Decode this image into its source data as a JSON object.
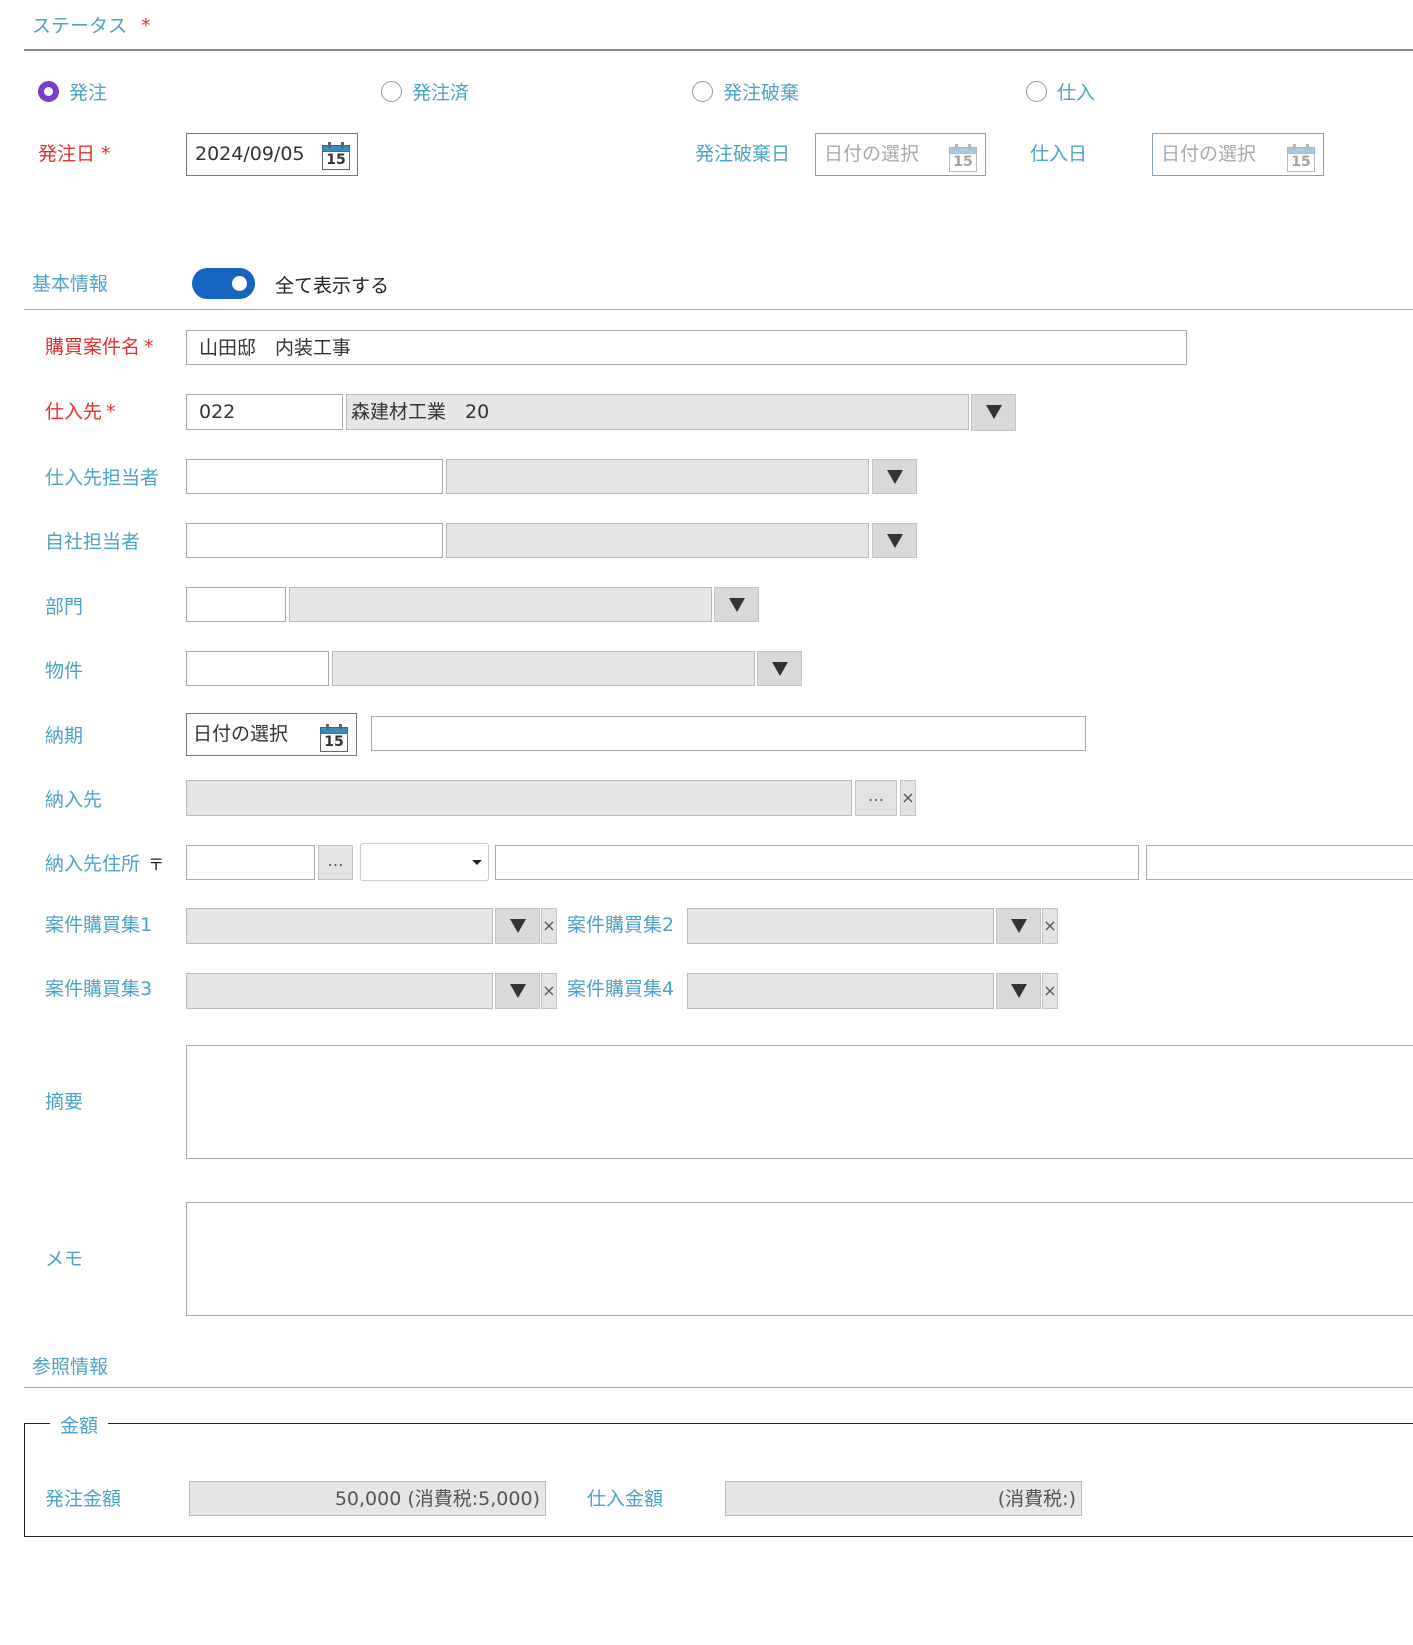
{
  "status": {
    "section_label": "ステータス",
    "required_mark": "*",
    "options": [
      {
        "label": "発注",
        "checked": true
      },
      {
        "label": "発注済",
        "checked": false
      },
      {
        "label": "発注破棄",
        "checked": false
      },
      {
        "label": "仕入",
        "checked": false
      }
    ],
    "order_date_label": "発注日",
    "order_date_value": "2024/09/05",
    "cancel_date_label": "発注破棄日",
    "cancel_date_placeholder": "日付の選択",
    "purchase_date_label": "仕入日",
    "purchase_date_placeholder": "日付の選択",
    "calendar_day": "15"
  },
  "basic": {
    "section_label": "基本情報",
    "toggle_label": "全て表示する",
    "toggle_on": true,
    "project_name_label": "購買案件名",
    "project_name_value": "山田邸　内装工事",
    "supplier_label": "仕入先",
    "supplier_code": "022",
    "supplier_name": "森建材工業　20",
    "supplier_contact_label": "仕入先担当者",
    "own_contact_label": "自社担当者",
    "department_label": "部門",
    "property_label": "物件",
    "delivery_date_label": "納期",
    "delivery_date_placeholder": "日付の選択",
    "delivery_to_label": "納入先",
    "delivery_address_label": "納入先住所",
    "postal_mark": "〒",
    "ellipsis": "…",
    "clear": "×",
    "purchase_group1_label": "案件購買集1",
    "purchase_group2_label": "案件購買集2",
    "purchase_group3_label": "案件購買集3",
    "purchase_group4_label": "案件購買集4",
    "summary_label": "摘要",
    "memo_label": "メモ"
  },
  "reference": {
    "section_label": "参照情報",
    "amount_legend": "金額",
    "order_amount_label": "発注金額",
    "order_amount_value": "50,000 (消費税:5,000)",
    "purchase_amount_label": "仕入金額",
    "purchase_amount_value": "(消費税:)"
  }
}
